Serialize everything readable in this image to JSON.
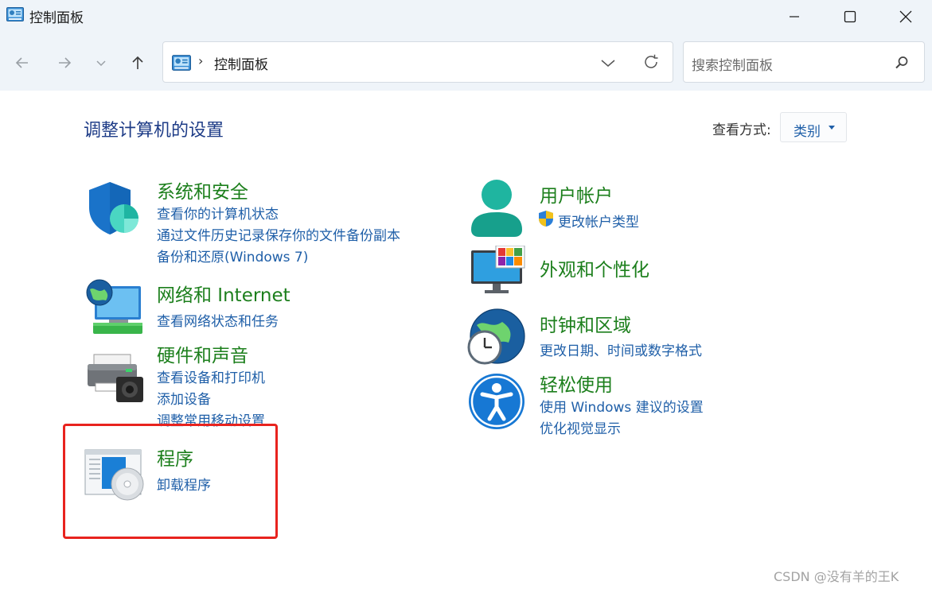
{
  "window": {
    "title": "控制面板",
    "minimize": "minimize",
    "maximize": "maximize",
    "close": "close"
  },
  "nav": {
    "back": "back",
    "forward": "forward",
    "recent": "recent-locations",
    "up": "up"
  },
  "address": {
    "separator": "›",
    "path": "控制面板"
  },
  "search": {
    "placeholder": "搜索控制面板"
  },
  "main": {
    "heading": "调整计算机的设置",
    "view_by_label": "查看方式:",
    "view_by_value": "类别"
  },
  "categories": {
    "system_security": {
      "title": "系统和安全",
      "links": [
        "查看你的计算机状态",
        "通过文件历史记录保存你的文件备份副本",
        "备份和还原(Windows 7)"
      ]
    },
    "network": {
      "title": "网络和 Internet",
      "links": [
        "查看网络状态和任务"
      ]
    },
    "hardware": {
      "title": "硬件和声音",
      "links": [
        "查看设备和打印机",
        "添加设备",
        "调整常用移动设置"
      ]
    },
    "programs": {
      "title": "程序",
      "links": [
        "卸载程序"
      ]
    },
    "user_accounts": {
      "title": "用户帐户",
      "links": [
        "更改帐户类型"
      ]
    },
    "appearance": {
      "title": "外观和个性化",
      "links": []
    },
    "clock_region": {
      "title": "时钟和区域",
      "links": [
        "更改日期、时间或数字格式"
      ]
    },
    "ease_of_access": {
      "title": "轻松使用",
      "links": [
        "使用 Windows 建议的设置",
        "优化视觉显示"
      ]
    }
  },
  "watermark": "CSDN @没有羊的王K",
  "colors": {
    "category_title": "#1c7f1c",
    "link": "#1f5fa8",
    "heading": "#1e3c87",
    "highlight": "#e8231e",
    "chrome": "#eff4f9"
  }
}
